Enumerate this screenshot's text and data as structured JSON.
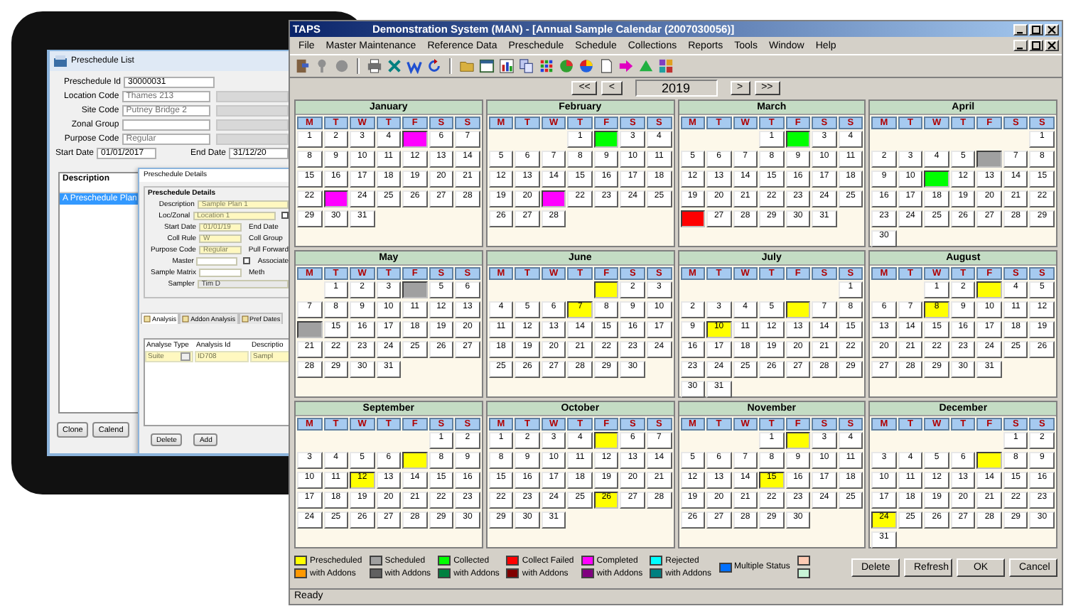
{
  "tablet_window": {
    "title": "Preschedule List",
    "fields": [
      {
        "label": "Preschedule Id",
        "value": "30000031",
        "kind": "plain"
      },
      {
        "label": "Location Code",
        "value": "Thames 213",
        "kind": "lookup"
      },
      {
        "label": "Site Code",
        "value": "Putney Bridge 2",
        "kind": "lookup"
      },
      {
        "label": "Zonal Group",
        "kind": "lookup"
      },
      {
        "label": "Purpose Code",
        "value": "Regular",
        "kind": "lookup"
      }
    ],
    "start_date": {
      "label": "Start Date",
      "value": "01/01/2017"
    },
    "end_date": {
      "label": "End Date",
      "value": "31/12/20"
    },
    "list": {
      "header": "Description",
      "rows": [
        {
          "text": "A Preschedule Plan",
          "selected": true
        }
      ]
    },
    "buttons": [
      "Clone",
      "Calend"
    ],
    "details": {
      "title": "Preschedule Details",
      "group_title": "Preschedule Details",
      "rows": [
        {
          "label": "Description",
          "value": "Sample Plan 1",
          "kind": "required"
        },
        {
          "label": "Loc/Zonal",
          "value": "Location 1",
          "kind": "required",
          "checkbox": {
            "checked": false
          }
        },
        {
          "label": "Start Date",
          "value": "01/01/19",
          "kind": "required",
          "right_label": "End Date"
        },
        {
          "label": "Coll Rule",
          "value": "W",
          "kind": "required",
          "right_label": "Coll Group"
        },
        {
          "label": "Purpose Code",
          "value": "Regular",
          "kind": "required",
          "right_label": "Pull Forward"
        },
        {
          "label": "Master",
          "kind": "optional",
          "checkbox": {
            "checked": false,
            "label": "Associate"
          }
        },
        {
          "label": "Sample Matrix",
          "kind": "optional",
          "right_label": "Meth"
        },
        {
          "label": "Sampler",
          "value": "Tim D",
          "kind": "readonly"
        }
      ],
      "tabs": [
        {
          "label": "Analysis",
          "selected": true
        },
        {
          "label": "Addon Analysis",
          "selected": false
        },
        {
          "label": "Pref Dates",
          "selected": false
        }
      ],
      "grid": {
        "columns": [
          "Analyse Type",
          "Analysis Id",
          "Descriptio"
        ],
        "rows": [
          [
            "Suite",
            "ID708",
            "Sampl"
          ]
        ]
      },
      "buttons": [
        "Delete",
        "Add"
      ]
    }
  },
  "window": {
    "app": "TAPS",
    "title": "Demonstration System (MAN) - [Annual Sample Calendar (2007030056)]"
  },
  "menu": [
    "File",
    "Master Maintenance",
    "Reference Data",
    "Preschedule",
    "Schedule",
    "Collections",
    "Reports",
    "Tools",
    "Window",
    "Help"
  ],
  "year_nav": {
    "first": "<<",
    "prev": "<",
    "year": "2019",
    "next": ">",
    "last": ">>"
  },
  "months": [
    {
      "name": "January",
      "weekdays": [
        "M",
        "T",
        "W",
        "T",
        "F",
        "S",
        "S"
      ],
      "weeks": [
        {
          "kind": "first",
          "days": [
            "1",
            "2",
            "3",
            "4",
            {
              "color": "#ff00ff"
            },
            "6",
            "7"
          ]
        },
        {
          "kind": "full",
          "days": [
            "8",
            "9",
            "10",
            "11",
            "12",
            "13",
            "14"
          ]
        },
        {
          "kind": "full",
          "days": [
            "15",
            "16",
            "17",
            "18",
            "19",
            "20",
            "21"
          ]
        },
        {
          "kind": "full",
          "days": [
            "22",
            {
              "color": "#ff00ff"
            },
            "24",
            "25",
            "26",
            "27",
            "28"
          ]
        },
        {
          "kind": "last",
          "days": [
            "29",
            "30",
            "31"
          ]
        }
      ]
    },
    {
      "name": "February",
      "weekdays": [
        "M",
        "T",
        "W",
        "T",
        "F",
        "S",
        "S"
      ],
      "weeks": [
        {
          "kind": "first",
          "days": [
            "1",
            {
              "color": "#00ff00"
            },
            "3",
            "4"
          ]
        },
        {
          "kind": "full",
          "days": [
            "5",
            "6",
            "7",
            "8",
            "9",
            "10",
            "11"
          ]
        },
        {
          "kind": "full",
          "days": [
            "12",
            "13",
            "14",
            "15",
            "16",
            "17",
            "18"
          ]
        },
        {
          "kind": "full",
          "days": [
            "19",
            "20",
            {
              "color": "#ff00ff"
            },
            "22",
            "23",
            "24",
            "25"
          ]
        },
        {
          "kind": "last",
          "days": [
            "26",
            "27",
            "28"
          ]
        }
      ]
    },
    {
      "name": "March",
      "weekdays": [
        "M",
        "T",
        "W",
        "T",
        "F",
        "S",
        "S"
      ],
      "weeks": [
        {
          "kind": "first",
          "days": [
            "1",
            {
              "color": "#00ff00"
            },
            "3",
            "4"
          ]
        },
        {
          "kind": "full",
          "days": [
            "5",
            "6",
            "7",
            "8",
            "9",
            "10",
            "11"
          ]
        },
        {
          "kind": "full",
          "days": [
            "12",
            "13",
            "14",
            "15",
            "16",
            "17",
            "18"
          ]
        },
        {
          "kind": "full",
          "days": [
            "19",
            "20",
            "21",
            "22",
            "23",
            "24",
            "25"
          ]
        },
        {
          "kind": "last",
          "days": [
            {
              "color": "#ff0000"
            },
            "27",
            "28",
            "29",
            "30",
            "31"
          ]
        }
      ]
    },
    {
      "name": "April",
      "weekdays": [
        "M",
        "T",
        "W",
        "T",
        "F",
        "S",
        "S"
      ],
      "weeks": [
        {
          "kind": "first",
          "days": [
            "1"
          ]
        },
        {
          "kind": "full",
          "days": [
            "2",
            "3",
            "4",
            "5",
            {
              "color": "#a0a0a0"
            },
            "7",
            "8"
          ]
        },
        {
          "kind": "full",
          "days": [
            "9",
            "10",
            {
              "color": "#00ff00"
            },
            "12",
            "13",
            "14",
            "15"
          ]
        },
        {
          "kind": "full",
          "days": [
            "16",
            "17",
            "18",
            "19",
            "20",
            "21",
            "22"
          ]
        },
        {
          "kind": "full",
          "days": [
            "23",
            "24",
            "25",
            "26",
            "27",
            "28",
            "29"
          ]
        },
        {
          "kind": "last",
          "days": [
            "30"
          ]
        }
      ]
    },
    {
      "name": "May",
      "weekdays": [
        "M",
        "T",
        "W",
        "T",
        "F",
        "S",
        "S"
      ],
      "weeks": [
        {
          "kind": "first",
          "days": [
            "1",
            "2",
            "3",
            {
              "color": "#a0a0a0"
            },
            "5",
            "6"
          ]
        },
        {
          "kind": "full",
          "days": [
            "7",
            "8",
            "9",
            "10",
            "11",
            "12",
            "13"
          ]
        },
        {
          "kind": "full",
          "days": [
            {
              "color": "#a0a0a0"
            },
            "15",
            "16",
            "17",
            "18",
            "19",
            "20"
          ]
        },
        {
          "kind": "full",
          "days": [
            "21",
            "22",
            "23",
            "24",
            "25",
            "26",
            "27"
          ]
        },
        {
          "kind": "last",
          "days": [
            "28",
            "29",
            "30",
            "31"
          ]
        }
      ]
    },
    {
      "name": "June",
      "weekdays": [
        "M",
        "T",
        "W",
        "T",
        "F",
        "S",
        "S"
      ],
      "weeks": [
        {
          "kind": "first",
          "days": [
            {
              "color": "#ffff00"
            },
            "2",
            "3"
          ]
        },
        {
          "kind": "full",
          "days": [
            "4",
            "5",
            "6",
            {
              "day": "7",
              "color": "#ffff00"
            },
            "8",
            "9",
            "10"
          ]
        },
        {
          "kind": "full",
          "days": [
            "11",
            "12",
            "13",
            "14",
            "15",
            "16",
            "17"
          ]
        },
        {
          "kind": "full",
          "days": [
            "18",
            "19",
            "20",
            "21",
            "22",
            "23",
            "24"
          ]
        },
        {
          "kind": "last",
          "days": [
            "25",
            "26",
            "27",
            "28",
            "29",
            "30"
          ]
        }
      ]
    },
    {
      "name": "July",
      "weekdays": [
        "M",
        "T",
        "W",
        "T",
        "F",
        "S",
        "S"
      ],
      "weeks": [
        {
          "kind": "first",
          "days": [
            "1"
          ]
        },
        {
          "kind": "full",
          "days": [
            "2",
            "3",
            "4",
            "5",
            {
              "color": "#ffff00"
            },
            "7",
            "8"
          ]
        },
        {
          "kind": "full",
          "days": [
            "9",
            {
              "day": "10",
              "color": "#ffff00"
            },
            "11",
            "12",
            "13",
            "14",
            "15"
          ]
        },
        {
          "kind": "full",
          "days": [
            "16",
            "17",
            "18",
            "19",
            "20",
            "21",
            "22"
          ]
        },
        {
          "kind": "full",
          "days": [
            "23",
            "24",
            "25",
            "26",
            "27",
            "28",
            "29"
          ]
        },
        {
          "kind": "last",
          "days": [
            "30",
            "31"
          ]
        }
      ]
    },
    {
      "name": "August",
      "weekdays": [
        "M",
        "T",
        "W",
        "T",
        "F",
        "S",
        "S"
      ],
      "weeks": [
        {
          "kind": "first",
          "days": [
            "1",
            "2",
            {
              "color": "#ffff00"
            },
            "4",
            "5"
          ]
        },
        {
          "kind": "full",
          "days": [
            "6",
            "7",
            {
              "day": "8",
              "color": "#ffff00"
            },
            "9",
            "10",
            "11",
            "12"
          ]
        },
        {
          "kind": "full",
          "days": [
            "13",
            "14",
            "15",
            "16",
            "17",
            "18",
            "19"
          ]
        },
        {
          "kind": "full",
          "days": [
            "20",
            "21",
            "22",
            "23",
            "24",
            "25",
            "26"
          ]
        },
        {
          "kind": "last",
          "days": [
            "27",
            "28",
            "29",
            "30",
            "31"
          ]
        }
      ]
    },
    {
      "name": "September",
      "weekdays": [
        "M",
        "T",
        "W",
        "T",
        "F",
        "S",
        "S"
      ],
      "weeks": [
        {
          "kind": "first",
          "days": [
            "1",
            "2"
          ]
        },
        {
          "kind": "full",
          "days": [
            "3",
            "4",
            "5",
            "6",
            {
              "color": "#ffff00"
            },
            "8",
            "9"
          ]
        },
        {
          "kind": "full",
          "days": [
            "10",
            "11",
            {
              "day": "12",
              "color": "#ffff00"
            },
            "13",
            "14",
            "15",
            "16"
          ]
        },
        {
          "kind": "full",
          "days": [
            "17",
            "18",
            "19",
            "20",
            "21",
            "22",
            "23"
          ]
        },
        {
          "kind": "full",
          "days": [
            "24",
            "25",
            "26",
            "27",
            "28",
            "29",
            "30"
          ]
        }
      ]
    },
    {
      "name": "October",
      "weekdays": [
        "M",
        "T",
        "W",
        "T",
        "F",
        "S",
        "S"
      ],
      "weeks": [
        {
          "kind": "first",
          "days": [
            "1",
            "2",
            "3",
            "4",
            {
              "color": "#ffff00"
            },
            "6",
            "7"
          ]
        },
        {
          "kind": "full",
          "days": [
            "8",
            "9",
            "10",
            "11",
            "12",
            "13",
            "14"
          ]
        },
        {
          "kind": "full",
          "days": [
            "15",
            "16",
            "17",
            "18",
            "19",
            "20",
            "21"
          ]
        },
        {
          "kind": "full",
          "days": [
            "22",
            "23",
            "24",
            "25",
            {
              "day": "26",
              "color": "#ffff00"
            },
            "27",
            "28"
          ]
        },
        {
          "kind": "last",
          "days": [
            "29",
            "30",
            "31"
          ]
        }
      ]
    },
    {
      "name": "November",
      "weekdays": [
        "M",
        "T",
        "W",
        "T",
        "F",
        "S",
        "S"
      ],
      "weeks": [
        {
          "kind": "first",
          "days": [
            "1",
            {
              "color": "#ffff00"
            },
            "3",
            "4"
          ]
        },
        {
          "kind": "full",
          "days": [
            "5",
            "6",
            "7",
            "8",
            "9",
            "10",
            "11"
          ]
        },
        {
          "kind": "full",
          "days": [
            "12",
            "13",
            "14",
            {
              "day": "15",
              "color": "#ffff00"
            },
            "16",
            "17",
            "18"
          ]
        },
        {
          "kind": "full",
          "days": [
            "19",
            "20",
            "21",
            "22",
            "23",
            "24",
            "25"
          ]
        },
        {
          "kind": "last",
          "days": [
            "26",
            "27",
            "28",
            "29",
            "30"
          ]
        }
      ]
    },
    {
      "name": "December",
      "weekdays": [
        "M",
        "T",
        "W",
        "T",
        "F",
        "S",
        "S"
      ],
      "weeks": [
        {
          "kind": "first",
          "days": [
            "1",
            "2"
          ]
        },
        {
          "kind": "full",
          "days": [
            "3",
            "4",
            "5",
            "6",
            {
              "color": "#ffff00"
            },
            "8",
            "9"
          ]
        },
        {
          "kind": "full",
          "days": [
            "10",
            "11",
            "12",
            "13",
            "14",
            "15",
            "16"
          ]
        },
        {
          "kind": "full",
          "days": [
            "17",
            "18",
            "19",
            "20",
            "21",
            "22",
            "23"
          ]
        },
        {
          "kind": "full",
          "days": [
            {
              "day": "24",
              "color": "#ffff00"
            },
            "25",
            "26",
            "27",
            "28",
            "29",
            "30"
          ]
        },
        {
          "kind": "last",
          "days": [
            "31"
          ]
        }
      ]
    }
  ],
  "legend": [
    {
      "entries": [
        {
          "label": "Prescheduled",
          "color": "#ffff00"
        },
        {
          "label": "with Addons",
          "color": "#ff9900"
        }
      ]
    },
    {
      "entries": [
        {
          "label": "Scheduled",
          "color": "#a0a0a0"
        },
        {
          "label": "with Addons",
          "color": "#606060"
        }
      ]
    },
    {
      "entries": [
        {
          "label": "Collected",
          "color": "#00ff00"
        },
        {
          "label": "with Addons",
          "color": "#008040"
        }
      ]
    },
    {
      "entries": [
        {
          "label": "Collect Failed",
          "color": "#ff0000"
        },
        {
          "label": "with Addons",
          "color": "#800000"
        }
      ]
    },
    {
      "entries": [
        {
          "label": "Completed",
          "color": "#ff00ff"
        },
        {
          "label": "with Addons",
          "color": "#800080"
        }
      ]
    },
    {
      "entries": [
        {
          "label": "Rejected",
          "color": "#00ffff"
        },
        {
          "label": "with Addons",
          "color": "#008080"
        }
      ]
    },
    {
      "entries": [
        {
          "label": "Multiple Status",
          "color": "#0070ff"
        }
      ]
    },
    {
      "entries": [
        {
          "color": "#ffcbb4"
        },
        {
          "color": "#c8f4d6"
        }
      ]
    }
  ],
  "buttons": [
    "Delete",
    "Refresh",
    "OK",
    "Cancel"
  ],
  "status_bar": "Ready"
}
